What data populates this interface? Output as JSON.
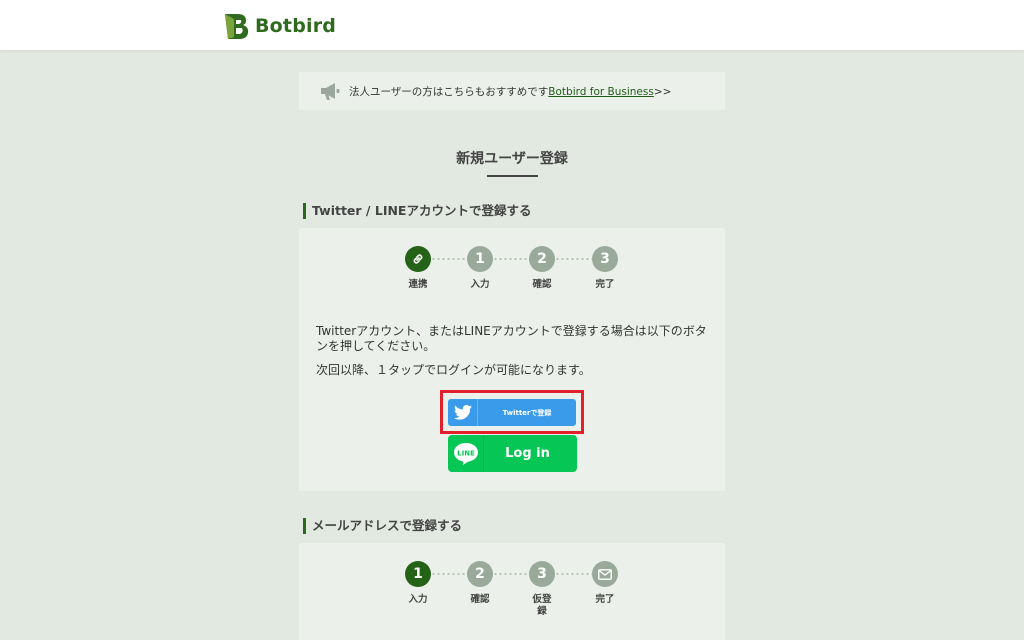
{
  "header": {
    "logo_text": "Botbird"
  },
  "notice": {
    "text": "法人ユーザーの方はこちらもおすすめです",
    "link_text": "Botbird for Business",
    "suffix": ">>"
  },
  "page_title": "新規ユーザー登録",
  "social_section": {
    "heading": "Twitter / LINEアカウントで登録する",
    "steps": [
      {
        "label": "連携",
        "icon": "link-icon"
      },
      {
        "label": "入力",
        "number": "1"
      },
      {
        "label": "確認",
        "number": "2"
      },
      {
        "label": "完了",
        "number": "3"
      }
    ],
    "description": "Twitterアカウント、またはLINEアカウントで登録する場合は以下のボタンを押してください。",
    "note": "次回以降、１タップでログインが可能になります。",
    "twitter_button": "Twitterで登録",
    "line_logo_text": "LINE",
    "line_button": "Log in"
  },
  "email_section": {
    "heading": "メールアドレスで登録する",
    "steps": [
      {
        "label": "入力",
        "number": "1"
      },
      {
        "label": "確認",
        "number": "2"
      },
      {
        "label": "仮登録",
        "number": "3"
      },
      {
        "label": "完了",
        "icon": "mail-icon"
      }
    ]
  },
  "colors": {
    "brand_green": "#246218",
    "background": "#e2e9e1",
    "card": "#ebf0ea",
    "twitter_blue": "#3a9bea",
    "line_green": "#06c755",
    "highlight_red": "#e0202b"
  }
}
